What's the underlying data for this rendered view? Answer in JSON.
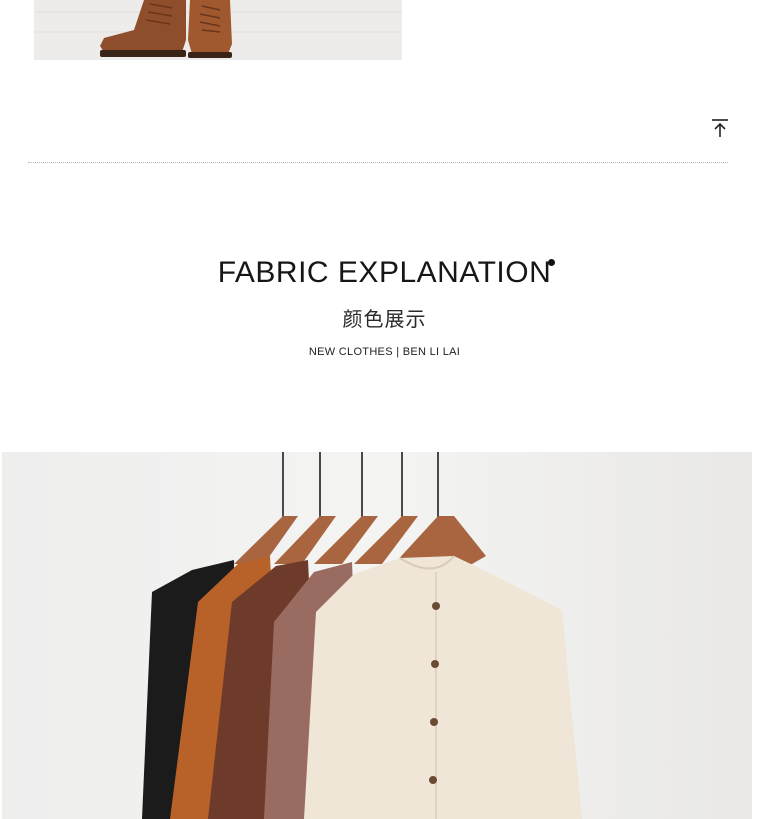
{
  "back_to_top": {
    "icon": "arrow-up-to-line-icon"
  },
  "section": {
    "title": "FABRIC EXPLANATION",
    "subtitle_cn": "颜色展示",
    "tagline": "NEW CLOTHES |  BEN  LI  LAI"
  },
  "images": {
    "top": {
      "icon": "boots-photo"
    },
    "product": {
      "icon": "shirts-on-hangers-photo"
    }
  },
  "colors": {
    "shirt_black": "#1b1b1b",
    "shirt_rust": "#b8622a",
    "shirt_brown": "#6e3a2a",
    "shirt_mauve": "#9a6b61",
    "shirt_cream": "#efe6d8",
    "hanger_wood": "#a8653f",
    "boot_tan": "#9a5a32"
  }
}
